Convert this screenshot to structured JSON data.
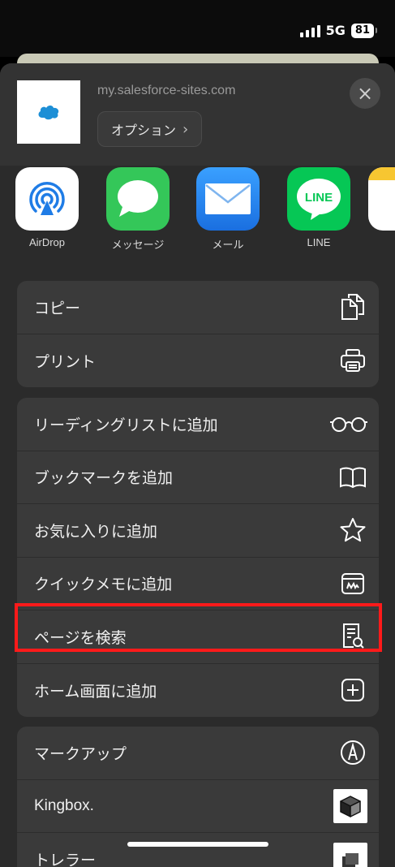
{
  "status_bar": {
    "network": "5G",
    "battery": "81"
  },
  "share_sheet": {
    "url": "my.salesforce-sites.com",
    "options_label": "オプション",
    "close_icon": "close-icon"
  },
  "apps": [
    {
      "label": "AirDrop",
      "icon": "airdrop-icon",
      "color": "#ffffff"
    },
    {
      "label": "メッセージ",
      "icon": "messages-icon",
      "color": "#34c759"
    },
    {
      "label": "メール",
      "icon": "mail-icon",
      "color": "#1e88f0"
    },
    {
      "label": "LINE",
      "icon": "line-icon",
      "color": "#06c755"
    },
    {
      "label": "",
      "icon": "notes-icon",
      "color": "#ffffff"
    }
  ],
  "group1": [
    {
      "label": "コピー",
      "icon": "copy-icon"
    },
    {
      "label": "プリント",
      "icon": "printer-icon"
    }
  ],
  "group2": [
    {
      "label": "リーディングリストに追加",
      "icon": "glasses-icon"
    },
    {
      "label": "ブックマークを追加",
      "icon": "book-icon"
    },
    {
      "label": "お気に入りに追加",
      "icon": "star-icon"
    },
    {
      "label": "クイックメモに追加",
      "icon": "quick-note-icon"
    },
    {
      "label": "ページを検索",
      "icon": "find-in-page-icon"
    },
    {
      "label": "ホーム画面に追加",
      "icon": "add-square-icon"
    }
  ],
  "group3": [
    {
      "label": "マークアップ",
      "icon": "markup-icon"
    },
    {
      "label": "Kingbox.",
      "icon": "kingbox-icon"
    },
    {
      "label": "トレラー",
      "icon": "app-extension-icon"
    }
  ],
  "colors": {
    "highlight": "#ff1a1a",
    "sheet": "#2b2b2b",
    "group": "#3a3a3a"
  }
}
